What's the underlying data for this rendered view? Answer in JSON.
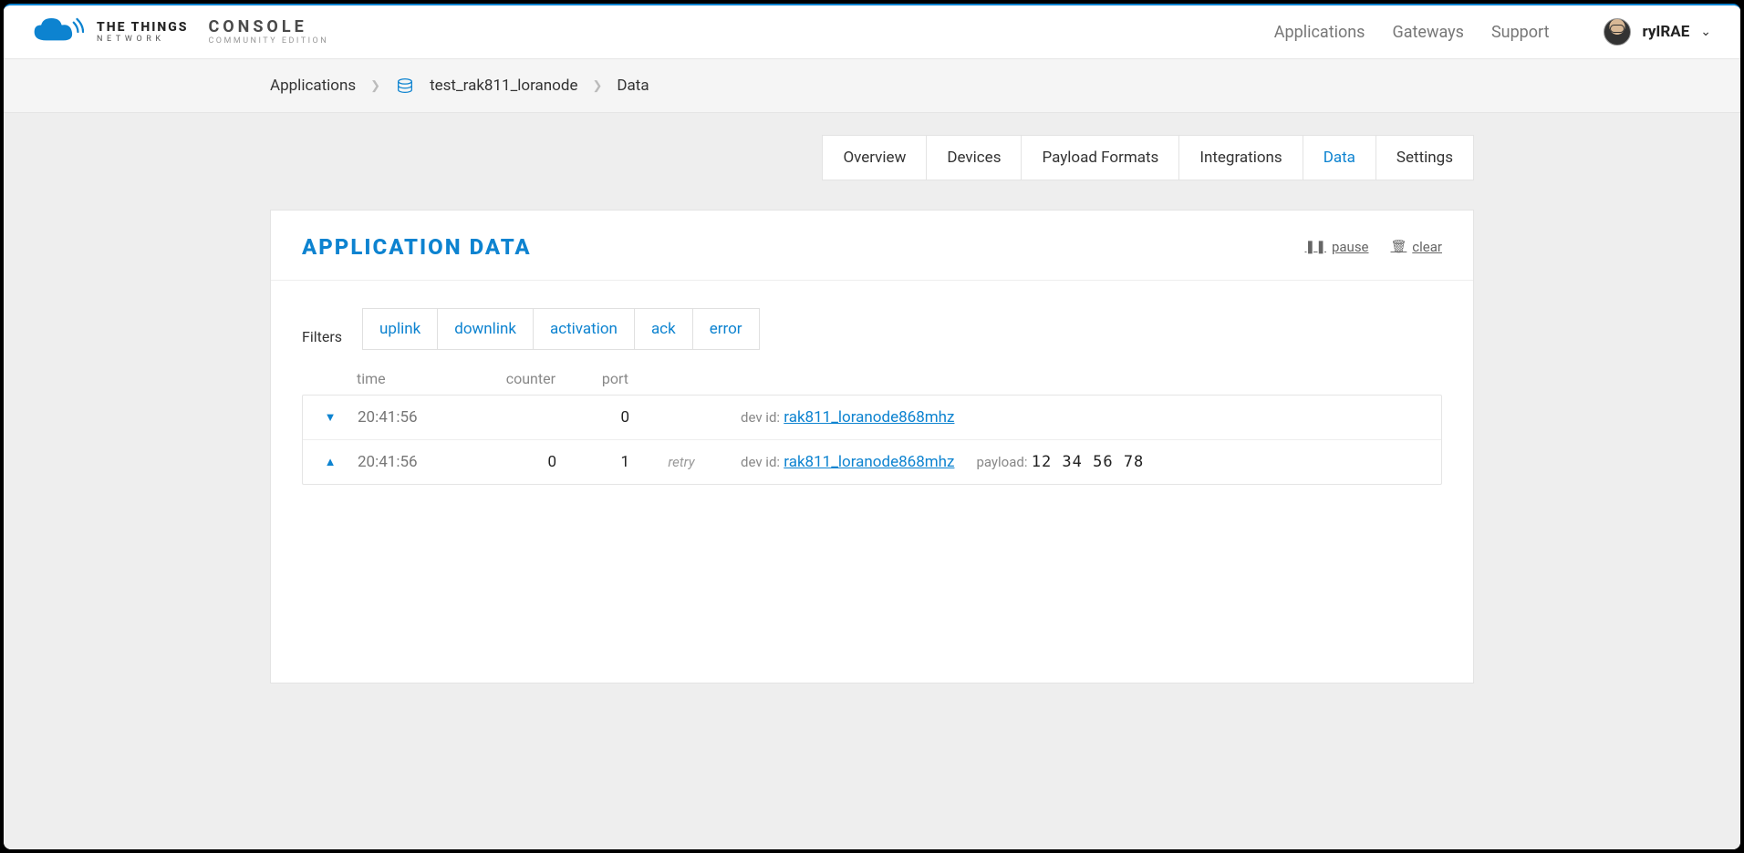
{
  "header": {
    "brand_line1": "THE THINGS",
    "brand_line2": "NETWORK",
    "console_line1": "CONSOLE",
    "console_line2": "COMMUNITY EDITION",
    "nav": {
      "applications": "Applications",
      "gateways": "Gateways",
      "support": "Support"
    },
    "username": "ryIRAE"
  },
  "breadcrumb": {
    "root": "Applications",
    "app": "test_rak811_loranode",
    "leaf": "Data"
  },
  "tabs": {
    "overview": "Overview",
    "devices": "Devices",
    "payload": "Payload Formats",
    "integrations": "Integrations",
    "data": "Data",
    "settings": "Settings"
  },
  "panel": {
    "title": "APPLICATION DATA",
    "pause": "pause",
    "clear": "clear"
  },
  "filters": {
    "label": "Filters",
    "uplink": "uplink",
    "downlink": "downlink",
    "activation": "activation",
    "ack": "ack",
    "error": "error"
  },
  "columns": {
    "time": "time",
    "counter": "counter",
    "port": "port"
  },
  "labels": {
    "devid": "dev id:",
    "payload": "payload:",
    "retry": "retry"
  },
  "rows": [
    {
      "direction": "down",
      "time": "20:41:56",
      "counter": "",
      "port": "0",
      "retry": "",
      "dev_id": "rak811_loranode868mhz",
      "payload": ""
    },
    {
      "direction": "up",
      "time": "20:41:56",
      "counter": "0",
      "port": "1",
      "retry": "retry",
      "dev_id": "rak811_loranode868mhz",
      "payload": "12 34 56 78"
    }
  ]
}
